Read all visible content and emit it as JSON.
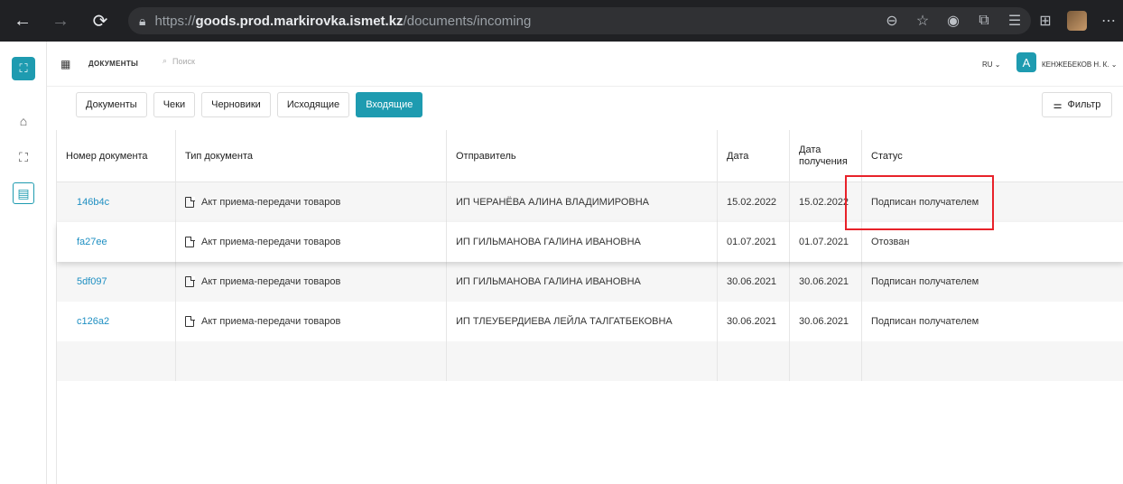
{
  "browser": {
    "url_scheme": "https://",
    "url_host": "goods.prod.markirovka.ismet.kz",
    "url_path": "/documents/incoming"
  },
  "header": {
    "title": "ДОКУМЕНТЫ",
    "search_placeholder": "Поиск",
    "lang": "RU",
    "user_initial": "А",
    "user_name": "КЕНЖЕБЕКОВ Н. К."
  },
  "tabs": [
    "Документы",
    "Чеки",
    "Черновики",
    "Исходящие",
    "Входящие"
  ],
  "active_tab": "Входящие",
  "filter_label": "Фильтр",
  "table": {
    "columns": [
      "Номер документа",
      "Тип документа",
      "Отправитель",
      "Дата",
      "Дата получения",
      "Статус"
    ],
    "rows": [
      {
        "number": "146b4c",
        "type": "Акт приема-передачи товаров",
        "sender": "ИП ЧЕРАНЁВА АЛИНА ВЛАДИМИРОВНА",
        "date": "15.02.2022",
        "received": "15.02.2022",
        "status": "Подписан получателем"
      },
      {
        "number": "fa27ee",
        "type": "Акт приема-передачи товаров",
        "sender": "ИП ГИЛЬМАНОВА ГАЛИНА ИВАНОВНА",
        "date": "01.07.2021",
        "received": "01.07.2021",
        "status": "Отозван"
      },
      {
        "number": "5df097",
        "type": "Акт приема-передачи товаров",
        "sender": "ИП ГИЛЬМАНОВА ГАЛИНА ИВАНОВНА",
        "date": "30.06.2021",
        "received": "30.06.2021",
        "status": "Подписан получателем"
      },
      {
        "number": "c126a2",
        "type": "Акт приема-передачи товаров",
        "sender": "ИП ТЛЕУБЕРДИЕВА ЛЕЙЛА ТАЛГАТБЕКОВНА",
        "date": "30.06.2021",
        "received": "30.06.2021",
        "status": "Подписан получателем"
      }
    ]
  },
  "colors": {
    "accent": "#1e9bb0",
    "link": "#1e8fc2",
    "highlight": "#e8222a"
  }
}
